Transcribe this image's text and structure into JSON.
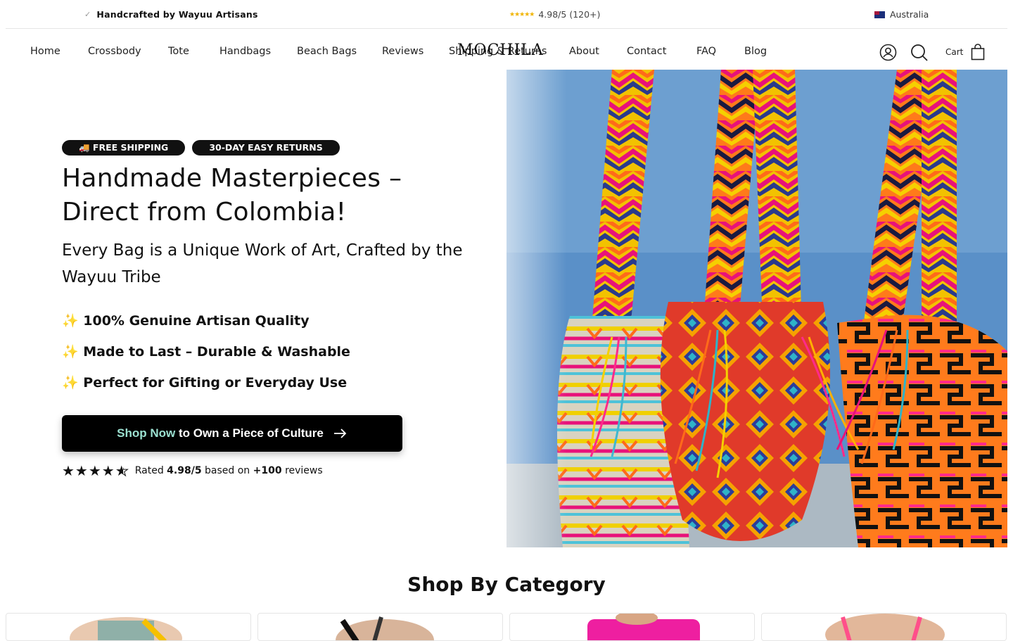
{
  "announcement": {
    "left_text": "Handcrafted by Wayuu Artisans",
    "mid_text": "4.98/5 (120+)",
    "region": "Australia"
  },
  "nav": {
    "items": [
      "Home",
      "Crossbody",
      "Tote",
      "Handbags",
      "Beach Bags",
      "Reviews",
      "Shipping & Returns",
      "About",
      "Contact",
      "FAQ",
      "Blog"
    ],
    "logo_text": "MOCHILA",
    "cart_label": "Cart",
    "icons": [
      "account-icon",
      "search-icon",
      "bag-icon"
    ]
  },
  "hero": {
    "badge_shipping": "🚚 FREE SHIPPING",
    "badge_returns": "30-DAY EASY RETURNS",
    "title": "Handmade Masterpieces – Direct from Colombia!",
    "subtitle": "Every Bag is a Unique Work of Art, Crafted by the Wayuu Tribe",
    "features": [
      "✨ 100% Genuine Artisan Quality",
      "✨ Made to Last – Durable & Washable",
      "✨ Perfect for Gifting or Everyday Use"
    ],
    "cta_green": "Shop Now",
    "cta_rest": "to Own a Piece of Culture",
    "rating_prefix": "Rated",
    "rating_value": "4.98/5",
    "rating_mid": "based on",
    "rating_count": "+100",
    "rating_suffix": "reviews",
    "stars": 4.5
  },
  "category": {
    "title": "Shop By Category"
  },
  "colors": {
    "accent": "#000000",
    "cta_highlight": "#9be0d0",
    "star_gold": "#f0b400"
  }
}
